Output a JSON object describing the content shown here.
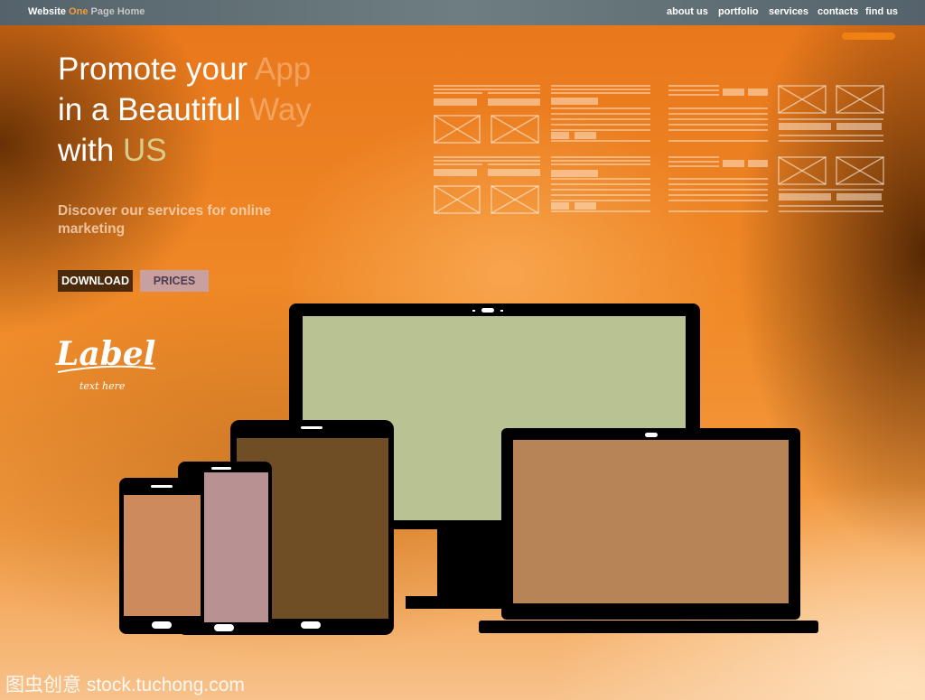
{
  "header": {
    "brand": {
      "word1": "Website",
      "word2": "One",
      "word3": "Page Home"
    },
    "nav": [
      "about us",
      "portfolio",
      "services",
      "contacts",
      "find us"
    ]
  },
  "hero": {
    "line1a": "Promote your",
    "line1b": "App",
    "line2a": "in a Beautiful",
    "line2b": "Way",
    "line3a": "with",
    "line3b": "US",
    "subtitle": "Discover our services for online marketing",
    "download_label": "DOWNLOAD",
    "prices_label": "PRICES"
  },
  "logo": {
    "script": "Label",
    "tagline": "text here"
  },
  "watermark": "图虫创意 stock.tuchong.com",
  "colors": {
    "accent": "#f07f14",
    "topbar": "#5f6f75",
    "download_bg": "#4a2a0a",
    "prices_bg": "#c9a0a0",
    "monitor_screen": "#b8c293",
    "laptop_screen": "#b78458",
    "tablet_screen": "#6f4e25",
    "phone1_screen": "#cd8a5c",
    "phone2_screen": "#b89292"
  }
}
